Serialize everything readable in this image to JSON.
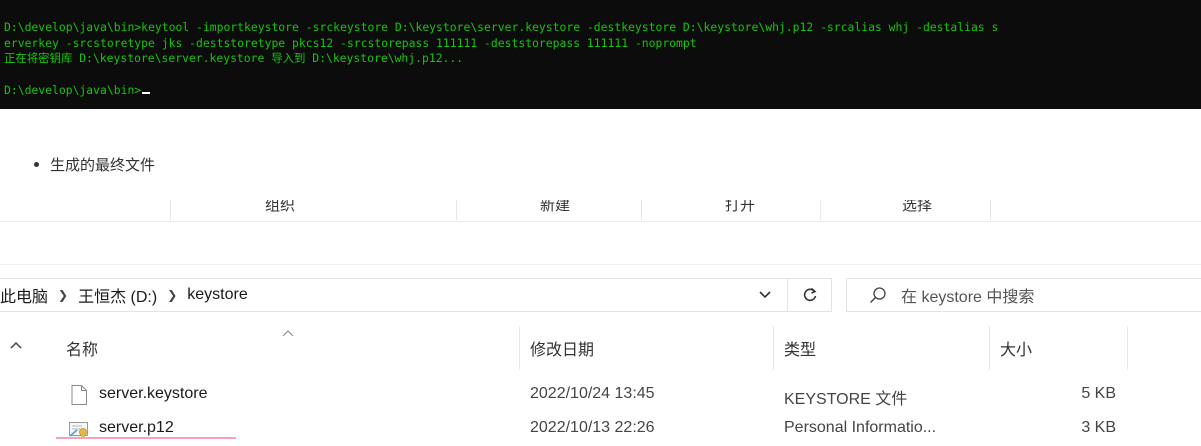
{
  "terminal": {
    "lines": [
      "D:\\develop\\java\\bin>keytool -importkeystore -srckeystore D:\\keystore\\server.keystore -destkeystore D:\\keystore\\whj.p12 -srcalias whj -destalias s",
      "erverkey -srcstoretype jks -deststoretype pkcs12 -srcstorepass 111111 -deststorepass 111111 -noprompt",
      "正在将密钥库 D:\\keystore\\server.keystore 导入到 D:\\keystore\\whj.p12...",
      "",
      "D:\\develop\\java\\bin>"
    ],
    "text_color": "#16c60c",
    "background": "#0c0c0c"
  },
  "bullet": {
    "text": "生成的最终文件"
  },
  "explorer": {
    "ribbon": [
      "组织",
      "新建",
      "打开",
      "选择"
    ],
    "breadcrumb": [
      "此电脑",
      "王恒杰 (D:)",
      "keystore"
    ],
    "search_placeholder": "在 keystore 中搜索",
    "columns": {
      "name": "名称",
      "date": "修改日期",
      "type": "类型",
      "size": "大小"
    },
    "files": [
      {
        "name": "server.keystore",
        "date": "2022/10/24 13:45",
        "type": "KEYSTORE 文件",
        "size": "5 KB",
        "icon": "blank-file-icon"
      },
      {
        "name": "server.p12",
        "date": "2022/10/13 22:26",
        "type": "Personal Informatio...",
        "size": "3 KB",
        "icon": "certificate-file-icon"
      }
    ]
  }
}
